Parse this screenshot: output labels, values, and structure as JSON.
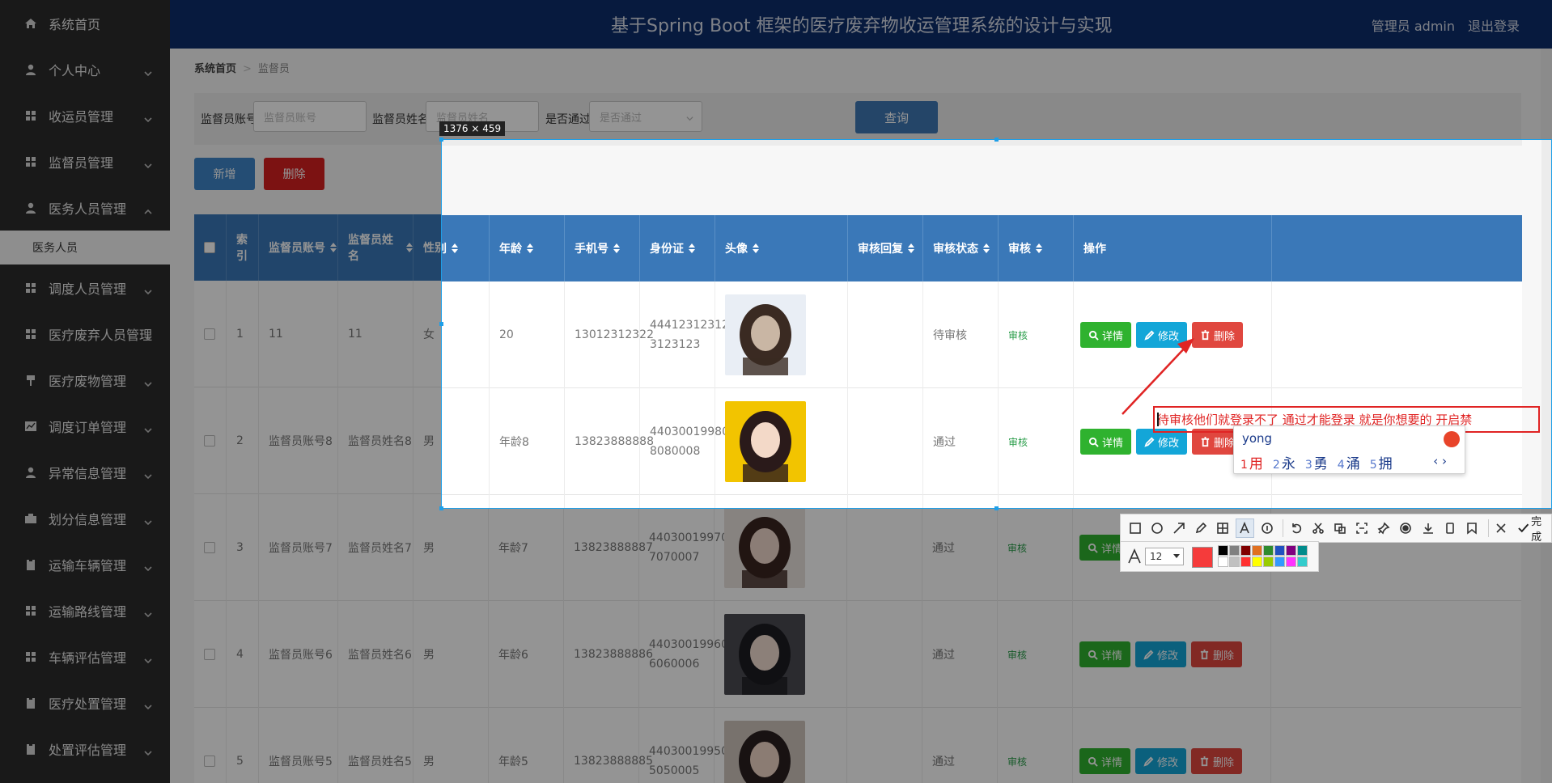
{
  "header": {
    "title": "基于Spring Boot 框架的医疗废弃物收运管理系统的设计与实现",
    "user": "管理员 admin",
    "logout": "退出登录"
  },
  "sidebar": {
    "items": [
      {
        "label": "系统首页",
        "icon": "home-icon"
      },
      {
        "label": "个人中心",
        "icon": "user-icon"
      },
      {
        "label": "收运员管理",
        "icon": "grid-icon"
      },
      {
        "label": "监督员管理",
        "icon": "grid-icon"
      },
      {
        "label": "医务人员管理",
        "icon": "user-icon"
      },
      {
        "label": "调度人员管理",
        "icon": "grid-icon"
      },
      {
        "label": "医疗废弃人员管理",
        "icon": "grid-icon"
      },
      {
        "label": "医疗废物管理",
        "icon": "brush-icon"
      },
      {
        "label": "调度订单管理",
        "icon": "chart-icon"
      },
      {
        "label": "异常信息管理",
        "icon": "user-icon"
      },
      {
        "label": "划分信息管理",
        "icon": "briefcase-icon"
      },
      {
        "label": "运输车辆管理",
        "icon": "clipboard-icon"
      },
      {
        "label": "运输路线管理",
        "icon": "grid-icon"
      },
      {
        "label": "车辆评估管理",
        "icon": "grid-icon"
      },
      {
        "label": "医疗处置管理",
        "icon": "clipboard-icon"
      },
      {
        "label": "处置评估管理",
        "icon": "clipboard-icon"
      }
    ],
    "sub_item": "医务人员"
  },
  "breadcrumb": {
    "home": "系统首页",
    "current": "监督员"
  },
  "search": {
    "account_label": "监督员账号",
    "account_placeholder": "监督员账号",
    "name_label": "监督员姓名",
    "name_placeholder": "监督员姓名",
    "pass_label": "是否通过",
    "pass_placeholder": "是否通过",
    "query": "查询"
  },
  "actions": {
    "add": "新增",
    "delete": "删除"
  },
  "table": {
    "headers": [
      "",
      "索引",
      "监督员账号",
      "监督员姓名",
      "性别",
      "年龄",
      "手机号",
      "身份证",
      "头像",
      "审核回复",
      "审核状态",
      "审核",
      "操作"
    ],
    "rows": [
      {
        "index": "1",
        "account": "11",
        "name": "11",
        "gender": "女",
        "age": "20",
        "phone": "13012312322",
        "id1": "44412312312",
        "id2": "3123123",
        "reply": "",
        "status": "待审核",
        "audit": "审核"
      },
      {
        "index": "2",
        "account": "监督员账号8",
        "name": "监督员姓名8",
        "gender": "男",
        "age": "年龄8",
        "phone": "13823888888",
        "id1": "44030019980",
        "id2": "8080008",
        "reply": "",
        "status": "通过",
        "audit": "审核"
      },
      {
        "index": "3",
        "account": "监督员账号7",
        "name": "监督员姓名7",
        "gender": "男",
        "age": "年龄7",
        "phone": "13823888887",
        "id1": "44030019970",
        "id2": "7070007",
        "reply": "",
        "status": "通过",
        "audit": "审核"
      },
      {
        "index": "4",
        "account": "监督员账号6",
        "name": "监督员姓名6",
        "gender": "男",
        "age": "年龄6",
        "phone": "13823888886",
        "id1": "44030019960",
        "id2": "6060006",
        "reply": "",
        "status": "通过",
        "audit": "审核"
      },
      {
        "index": "5",
        "account": "监督员账号5",
        "name": "监督员姓名5",
        "gender": "男",
        "age": "年龄5",
        "phone": "13823888885",
        "id1": "44030019950",
        "id2": "5050005",
        "reply": "",
        "status": "通过",
        "audit": "审核"
      }
    ],
    "op_detail": "详情",
    "op_edit": "修改",
    "op_remove": "删除"
  },
  "screenshot_tool": {
    "size_tag": "1376 × 459",
    "annotation_text": "待审核他们就登录不了  通过才能登录 就是你想要的 开启禁",
    "ime_pinyin": "yong",
    "ime_candidates": [
      {
        "n": "1",
        "c": "用"
      },
      {
        "n": "2",
        "c": "永"
      },
      {
        "n": "3",
        "c": "勇"
      },
      {
        "n": "4",
        "c": "涌"
      },
      {
        "n": "5",
        "c": "拥"
      }
    ],
    "ime_arrows": "‹ ›",
    "done": "完成",
    "font_size": "12",
    "accent_color": "#e02424",
    "palette": [
      "#000000",
      "#808080",
      "#800000",
      "#e07020",
      "#2e8b2e",
      "#2050c0",
      "#800080",
      "#008b8b",
      "#ffffff",
      "#c0c0c0",
      "#ff3030",
      "#ffff00",
      "#99cc00",
      "#3399ff",
      "#ff33ff",
      "#33cccc"
    ]
  }
}
